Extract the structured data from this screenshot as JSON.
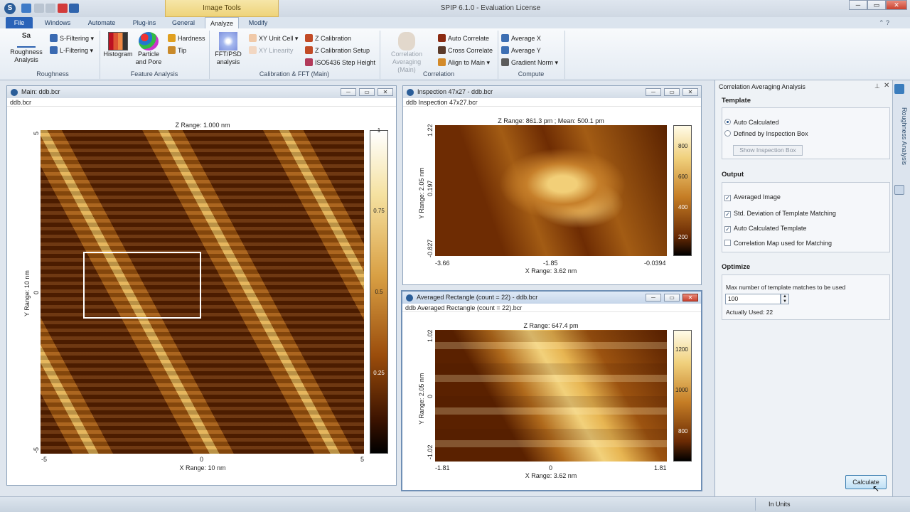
{
  "window": {
    "title": "SPIP 6.1.0 - Evaluation License",
    "context_group": "Image Tools"
  },
  "tabs": [
    "File",
    "Windows",
    "Automate",
    "Plug-ins",
    "General",
    "Analyze",
    "Modify"
  ],
  "ribbon": {
    "roughness": {
      "label": "Roughness",
      "big": "Roughness Analysis",
      "big_icon_text": "Sa",
      "s_filter": "S-Filtering",
      "l_filter": "L-Filtering"
    },
    "feature": {
      "label": "Feature Analysis",
      "histogram": "Histogram",
      "particle": "Particle and Pore",
      "hardness": "Hardness",
      "tip": "Tip"
    },
    "calib": {
      "label": "Calibration & FFT (Main)",
      "fft": "FFT/PSD analysis",
      "xy_unit": "XY Unit Cell",
      "xy_lin": "XY Linearity",
      "z_cal": "Z Calibration",
      "z_cal_setup": "Z Calibration Setup",
      "iso": "ISO5436 Step Height"
    },
    "correlation": {
      "label": "Correlation",
      "avg_main": "Correlation Averaging (Main)",
      "auto": "Auto Correlate",
      "cross": "Cross Correlate",
      "align": "Align to Main"
    },
    "compute": {
      "label": "Compute",
      "avg_x": "Average X",
      "avg_y": "Average Y",
      "grad": "Gradient Norm"
    }
  },
  "main_window": {
    "title": "Main: ddb.bcr",
    "path": "ddb.bcr",
    "zrange": "Z Range:  1.000 nm",
    "xrange": "X Range: 10 nm",
    "yrange": "Y Range: 10 nm",
    "xticks": [
      "-5",
      "0",
      "5"
    ],
    "yticks": [
      "5",
      "0",
      "-5"
    ],
    "cticks": [
      "1",
      "0.75",
      "0.5",
      "0.25"
    ]
  },
  "inspection_window": {
    "title": "Inspection 47x27 - ddb.bcr",
    "path": "ddb Inspection 47x27.bcr",
    "zrange": "Z Range:  861.3 pm ; Mean:  500.1 pm",
    "xrange": "X Range:  3.62 nm",
    "yrange": "Y Range:  2.05 nm",
    "xticks": [
      "-3.66",
      "-1.85",
      "-0.0394"
    ],
    "yticks": [
      "1.22",
      "0.197",
      "-0.827"
    ],
    "cticks": [
      "800",
      "600",
      "400",
      "200"
    ]
  },
  "averaged_window": {
    "title": "Averaged Rectangle (count = 22) - ddb.bcr",
    "path": "ddb Averaged Rectangle (count = 22).bcr",
    "zrange": "Z Range:  647.4 pm",
    "xrange": "X Range:  3.62 nm",
    "yrange": "Y Range:  2.05 nm",
    "xticks": [
      "-1.81",
      "0",
      "1.81"
    ],
    "yticks": [
      "1.02",
      "0",
      "-1.02"
    ],
    "cticks": [
      "1200",
      "1000",
      "800"
    ]
  },
  "panel": {
    "title": "Correlation Averaging Analysis",
    "template": {
      "heading": "Template",
      "auto": "Auto Calculated",
      "defined": "Defined by Inspection Box",
      "show_btn": "Show Inspection Box"
    },
    "output": {
      "heading": "Output",
      "items": [
        "Averaged Image",
        "Std. Deviation of Template Matching",
        "Auto Calculated Template",
        "Correlation Map used for Matching"
      ],
      "checked": [
        true,
        true,
        true,
        false
      ]
    },
    "optimize": {
      "heading": "Optimize",
      "max_label": "Max number of template matches to be used",
      "max_value": "100",
      "actually_used": "Actually Used: 22"
    },
    "calculate": "Calculate"
  },
  "sidebar": {
    "tab": "Roughness Analysis"
  },
  "status": {
    "units": "In Units"
  }
}
